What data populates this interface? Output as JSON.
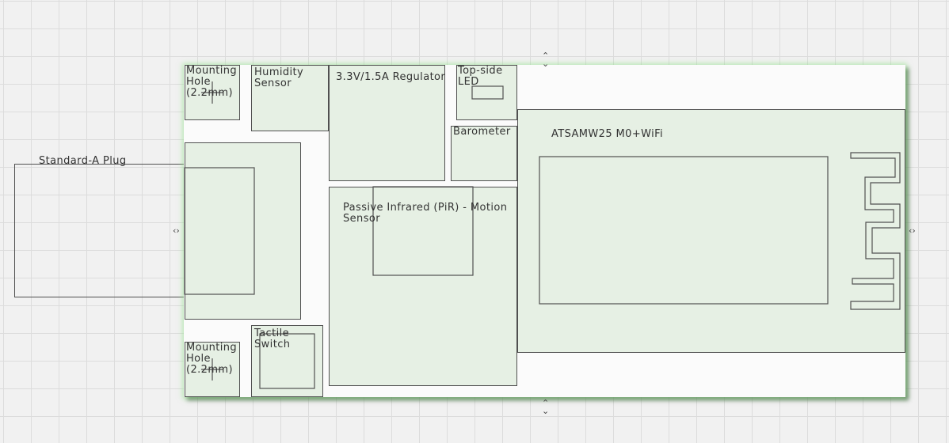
{
  "labels": {
    "mounting_hole_top": "Mounting\nHole\n(2.2mm)",
    "humidity": "Humidity\nSensor",
    "regulator": "3.3V/1.5A Regulator",
    "led": "Top-side\nLED",
    "barometer": "Barometer",
    "atsamw25": "ATSAMW25 M0+WiFi",
    "usb_plug": "Standard-A Plug",
    "pir": "Passive Infrared (PiR) - Motion\nSensor",
    "mounting_hole_bottom": "Mounting\nHole\n(2.2mm)",
    "tactile": "Tactile\nSwitch"
  },
  "icons": {
    "handle_up": "resize-vertical-icon",
    "handle_side": "resize-horizontal-icon"
  },
  "colors": {
    "component_fill": "#d6e8d2",
    "board_glow": "#96e68c",
    "outline": "#505050"
  }
}
